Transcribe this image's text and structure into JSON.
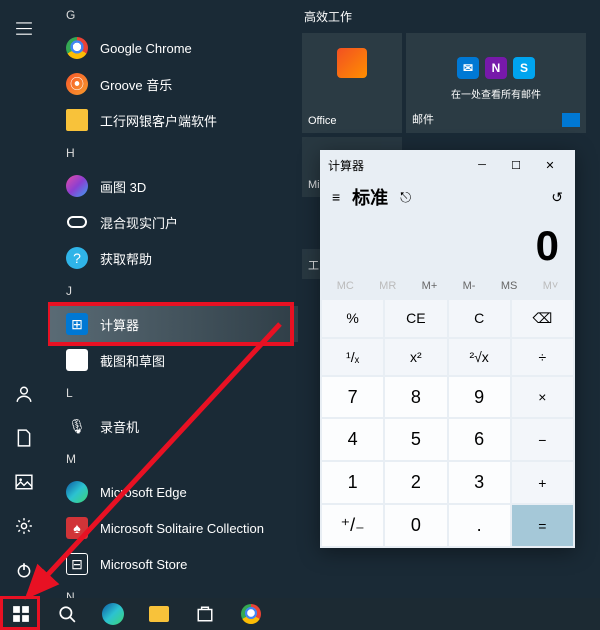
{
  "rail": {
    "menu": "menu",
    "user": "user",
    "docs": "docs",
    "pics": "pics",
    "settings": "settings",
    "power": "power"
  },
  "apps": {
    "G": "G",
    "chrome": "Google Chrome",
    "groove": "Groove 音乐",
    "icbc": "工行网银客户端软件",
    "H": "H",
    "paint3d": "画图 3D",
    "mr": "混合现实门户",
    "help": "获取帮助",
    "J": "J",
    "calc": "计算器",
    "snip": "截图和草图",
    "L": "L",
    "recorder": "录音机",
    "M": "M",
    "edge": "Microsoft Edge",
    "solitaire": "Microsoft Solitaire Collection",
    "store": "Microsoft Store",
    "N": "N"
  },
  "tiles": {
    "header": "高效工作",
    "office": "Office",
    "mail_title": "邮件",
    "mail_sub": "在一处查看所有邮件",
    "mi": "Mi",
    "gong": "工"
  },
  "calc": {
    "title": "计算器",
    "mode": "标准",
    "display": "0",
    "mem": {
      "mc": "MC",
      "mr": "MR",
      "mplus": "M+",
      "mminus": "M-",
      "ms": "MS",
      "mlist": "M˅"
    },
    "row1": {
      "a": "%",
      "b": "CE",
      "c": "C",
      "d": "⌫"
    },
    "row2": {
      "a": "¹/ₓ",
      "b": "x²",
      "c": "²√x",
      "d": "÷"
    },
    "row3": {
      "a": "7",
      "b": "8",
      "c": "9",
      "d": "×"
    },
    "row4": {
      "a": "4",
      "b": "5",
      "c": "6",
      "d": "−"
    },
    "row5": {
      "a": "1",
      "b": "2",
      "c": "3",
      "d": "+"
    },
    "row6": {
      "a": "⁺/₋",
      "b": "0",
      "c": ".",
      "d": "="
    }
  }
}
